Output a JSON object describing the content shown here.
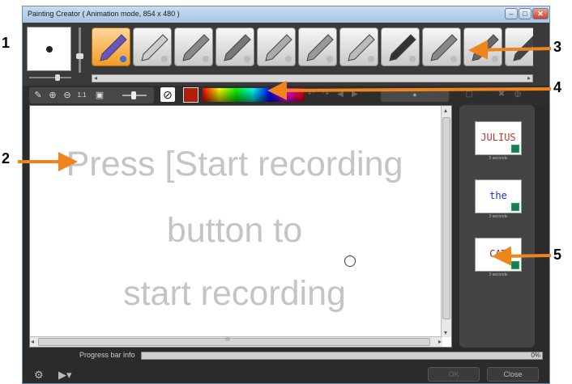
{
  "window": {
    "title": "Painting Creator ( Animation mode, 854 x 480 )",
    "controls": {
      "minimize": "–",
      "maximize": "□",
      "close": "✕"
    }
  },
  "toolbar": {
    "tools": [
      {
        "name": "paintbrush-tool-icon",
        "selected": true
      },
      {
        "name": "airbrush-tool-icon",
        "selected": false
      },
      {
        "name": "marker-tool-icon",
        "selected": false
      },
      {
        "name": "crayon-tool-icon",
        "selected": false
      },
      {
        "name": "chalk-tool-icon",
        "selected": false
      },
      {
        "name": "pencil-tool-icon",
        "selected": false
      },
      {
        "name": "highlighter-tool-icon",
        "selected": false
      },
      {
        "name": "oil-paint-tool-icon",
        "selected": false
      },
      {
        "name": "stamp-tool-icon",
        "selected": false
      },
      {
        "name": "charcoal-tool-icon",
        "selected": false
      },
      {
        "name": "eraser-tool-icon",
        "selected": false
      }
    ]
  },
  "color": {
    "current": "#b01e0a"
  },
  "canvas": {
    "placeholder_lines": [
      "Press [Start recording",
      "button to",
      "start recording"
    ],
    "hscroll_mark": "III"
  },
  "library": {
    "items": [
      {
        "word": "JULIUS",
        "color": "#c0392b",
        "caption": "5 seconds"
      },
      {
        "word": "the",
        "color": "#1a2fbf",
        "caption": "3 seconds"
      },
      {
        "word": "CAT",
        "color": "#8b2b1e",
        "caption": "3 seconds"
      }
    ]
  },
  "progress": {
    "label": "Progress bar info",
    "percent_text": "0%",
    "value": 0
  },
  "buttons": {
    "ok": "OK",
    "close": "Close"
  },
  "callouts": [
    "1",
    "2",
    "3",
    "4",
    "5"
  ]
}
